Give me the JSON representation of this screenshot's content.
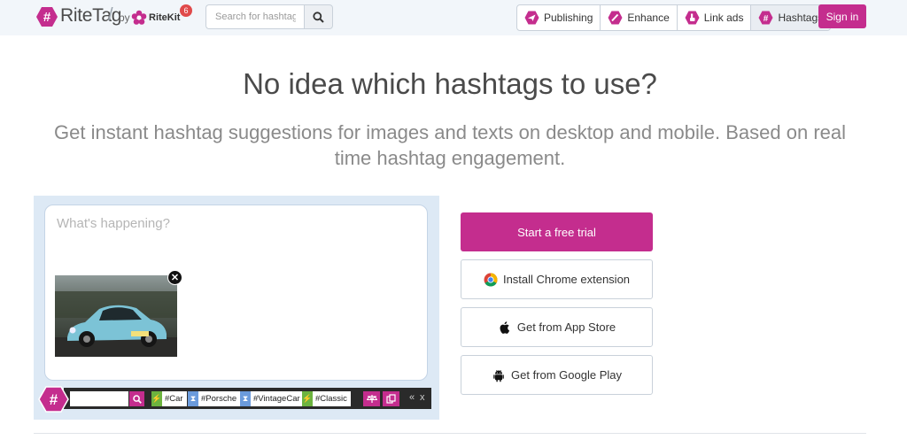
{
  "header": {
    "logo_text": "RiteTag",
    "by_text": "by",
    "partner_text": "RiteKit",
    "notification_count": "6",
    "search_placeholder": "Search for hashtags",
    "nav": [
      {
        "label": "Publishing",
        "icon": "paper-plane-icon"
      },
      {
        "label": "Enhance",
        "icon": "pencil-icon"
      },
      {
        "label": "Link ads",
        "icon": "pointer-hand-icon"
      },
      {
        "label": "Hashtags",
        "icon": "hashtag-icon"
      }
    ],
    "signin_label": "Sign in"
  },
  "hero": {
    "headline": "No idea which hashtags to use?",
    "subline": "Get instant hashtag suggestions for images and texts on desktop and mobile. Based on real time hashtag engagement."
  },
  "composer": {
    "placeholder": "What's happening?",
    "remove_label": "✕",
    "tags": [
      {
        "text": "#Car",
        "color": "green"
      },
      {
        "text": "#Porsche",
        "color": "blue"
      },
      {
        "text": "#VintageCar",
        "color": "blue"
      },
      {
        "text": "#Classic",
        "color": "green"
      }
    ],
    "controls": {
      "collapse": "«",
      "close": "x"
    }
  },
  "cta": {
    "trial": "Start a free trial",
    "chrome": "Install Chrome extension",
    "appstore": "Get from App Store",
    "googleplay": "Get from Google Play"
  },
  "colors": {
    "brand": "#c42d8e",
    "header_bg": "#f2f6fa",
    "panel_bg": "#dde9f5",
    "tag_green": "#6cb33f",
    "tag_blue": "#6b9bdc"
  }
}
